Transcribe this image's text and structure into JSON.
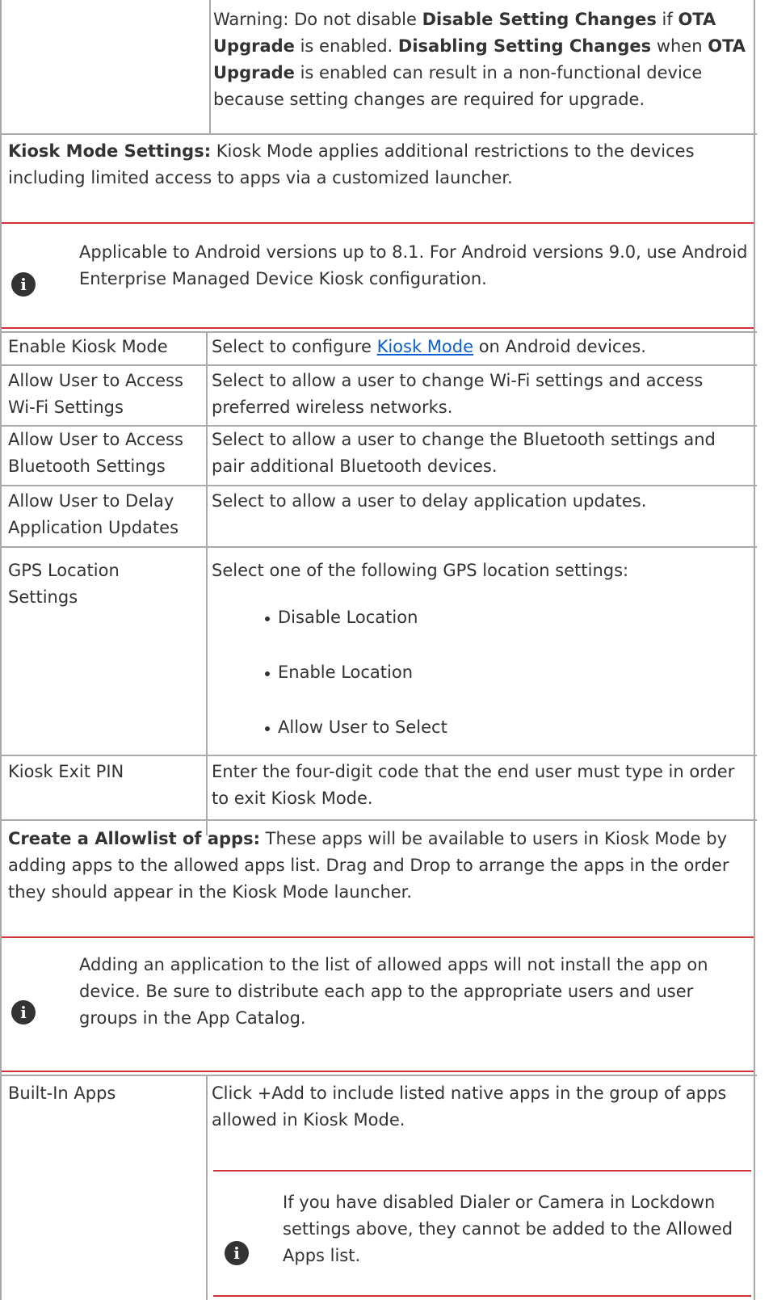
{
  "warning": {
    "prefix": "Warning: Do not disable ",
    "b1": "Disable Setting Changes",
    "mid1": " if ",
    "b2": "OTA Upgrade",
    "mid2": " is enabled. ",
    "b3": "Disabling Setting Changes",
    "mid3": " when ",
    "b4": "OTA Upgrade",
    "suffix": " is enabled can result in a non-functional device because setting changes are required for upgrade."
  },
  "kiosk_section": {
    "bold": "Kiosk Mode Settings:",
    "text": " Kiosk Mode applies additional restrictions to the devices including limited access to apps via a customized launcher.",
    "note": "Applicable to Android versions up to 8.1. For Android versions 9.0, use Android Enterprise Managed Device Kiosk configuration."
  },
  "rows": [
    {
      "label": "Enable Kiosk Mode",
      "desc_prefix": "Select to configure ",
      "desc_link": "Kiosk Mode",
      "desc_suffix": " on Android devices."
    },
    {
      "label": "Allow User to Access Wi-Fi Settings",
      "desc": "Select to allow a  user to change Wi-Fi settings and access preferred wireless networks."
    },
    {
      "label": "Allow User to Access Bluetooth Settings",
      "desc": "Select to allow a user to change the Bluetooth settings and pair additional Bluetooth devices."
    },
    {
      "label": "Allow User to Delay Application Updates",
      "desc": "Select to allow a user to delay application updates."
    },
    {
      "label": "GPS Location Settings",
      "desc": "Select one of the following GPS location settings:",
      "options": [
        "Disable Location",
        "Enable Location",
        "Allow User to Select"
      ]
    },
    {
      "label": "Kiosk Exit PIN",
      "desc": "Enter the four-digit code that the end user must type in order to exit Kiosk Mode."
    }
  ],
  "allowlist_section": {
    "bold": "Create a Allowlist of apps:",
    "text": " These apps will be available to users in Kiosk Mode by adding apps to the allowed apps list. Drag and Drop to arrange the apps in the order they should appear in the Kiosk Mode launcher.",
    "note": "Adding an application to the list of allowed apps will not install the app on device. Be sure to distribute each app to the appropriate users and user groups in the App Catalog."
  },
  "builtin": {
    "label": "Built-In Apps",
    "desc": "Click +Add to include listed native apps in the group of apps allowed in Kiosk Mode.",
    "note": "If you have disabled Dialer or Camera in Lockdown settings above, they cannot be added to the Allowed Apps list."
  },
  "icons": {
    "info": "info-icon"
  },
  "colors": {
    "note_rule": "#d13438",
    "link": "#0b5fd1",
    "border": "#a9a9a9"
  }
}
